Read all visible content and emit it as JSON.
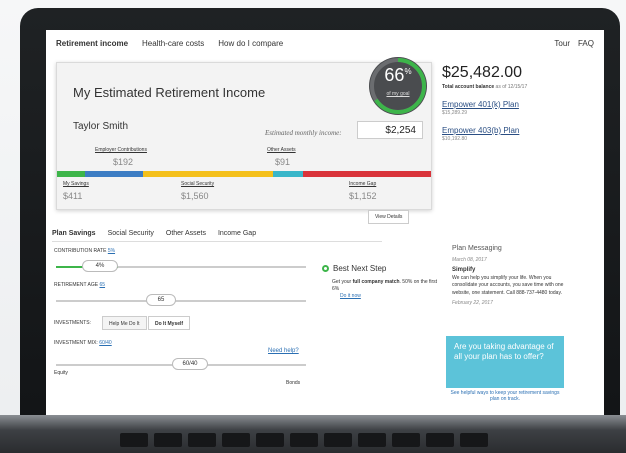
{
  "nav": {
    "tabs": [
      "Retirement income",
      "Health-care costs",
      "How do I compare"
    ],
    "right_links": [
      "Tour",
      "FAQ"
    ]
  },
  "estimate": {
    "title": "My Estimated Retirement Income",
    "name": "Taylor Smith",
    "monthly_label": "Estimated monthly income:",
    "monthly_value": "$2,254",
    "goal_pct": "66",
    "goal_pct_fraction": 0.66,
    "goal_unit": "%",
    "goal_label": "of my goal",
    "employer_label": "Employer Contributions",
    "employer_value": "$192",
    "other_label": "Other Assets",
    "other_value": "$91",
    "savings_label": "My Savings",
    "savings_value": "$411",
    "social_label": "Social Security",
    "social_value": "$1,560",
    "gap_label": "Income Gap",
    "gap_value": "$1,152",
    "view_details": "View Details",
    "bar_colors": [
      "#3db54a",
      "#3c7dc4",
      "#f4c01b",
      "#39b6c9",
      "#d9333a"
    ]
  },
  "balance": {
    "amount": "$25,482.00",
    "label": "Total account balance",
    "as_of": "as of 12/15/17",
    "plans": [
      {
        "name": "Empower 401(k) Plan",
        "value": "$15,289.29"
      },
      {
        "name": "Empower 403(b) Plan",
        "value": "$10,192.80"
      }
    ]
  },
  "lower_tabs": [
    "Plan Savings",
    "Social Security",
    "Other Assets",
    "Income Gap"
  ],
  "controls": {
    "contribution_label": "CONTRIBUTION RATE",
    "contribution_link": "5%",
    "contribution_value": "4%",
    "retirement_label": "RETIREMENT AGE",
    "retirement_link": "65",
    "retirement_value": "65",
    "investments_label": "INVESTMENTS:",
    "help_btn": "Help Me Do It",
    "myself_btn": "Do It Myself",
    "mix_label": "INVESTMENT MIX:",
    "mix_link": "60/40",
    "mix_value": "60/40",
    "mix_left": "Equity",
    "mix_right": "Bonds",
    "need_help": "Need help?"
  },
  "next_step": {
    "title": "Best Next Step",
    "body_prefix": "Get your ",
    "body_bold": "full company match",
    "body_suffix": ". 50% on the first 6%",
    "link": "Do it now"
  },
  "messaging": {
    "heading": "Plan Messaging",
    "date1": "March 08, 2017",
    "bold": "Simplify",
    "body": "We can help you simplify your life. When you consolidate your accounts, you save time with one website, one statement. Call 888-737-4480 today.",
    "date2": "February 22, 2017",
    "promo": "Are you taking advantage of all your plan has to offer?",
    "promo_link": "See helpful ways to keep your retirement savings plan on track."
  }
}
